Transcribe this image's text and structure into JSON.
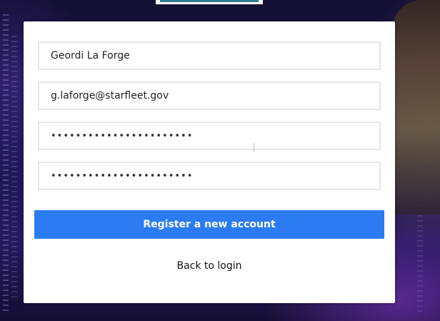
{
  "form": {
    "full_name_value": "Geordi La Forge",
    "email_value": "g.laforge@starfleet.gov",
    "password_masked": "•••••••••••••••••••••••",
    "confirm_password_masked": "•••••••••••••••••••••••"
  },
  "actions": {
    "register_label": "Register a new account",
    "back_to_login_label": "Back to login"
  },
  "colors": {
    "primary_button": "#2b7bf2",
    "field_border": "#e5e5e5",
    "card_background": "#ffffff"
  }
}
